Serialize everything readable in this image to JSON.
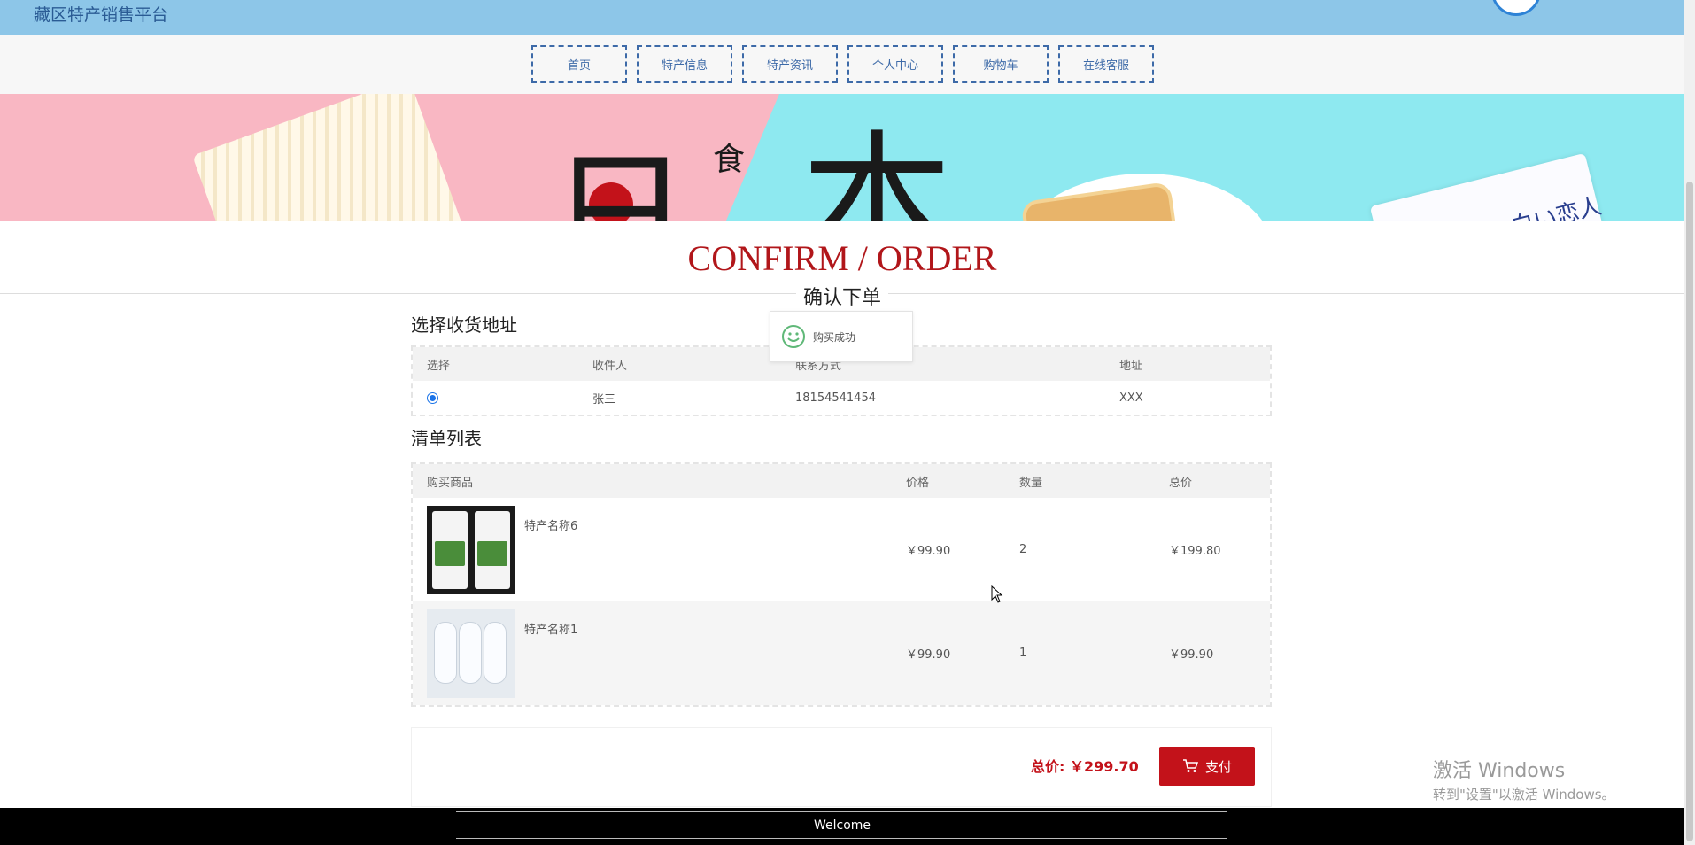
{
  "header": {
    "site_title": "藏区特产销售平台"
  },
  "nav": [
    {
      "label": "首页"
    },
    {
      "label": "特产信息"
    },
    {
      "label": "特产资讯"
    },
    {
      "label": "个人中心"
    },
    {
      "label": "购物车"
    },
    {
      "label": "在线客服"
    }
  ],
  "banner": {
    "k1": "日",
    "k2": "食",
    "k3": "本",
    "pack_text": "白い恋人"
  },
  "page": {
    "title_en": "CONFIRM / ORDER",
    "title_cn": "确认下单"
  },
  "toast": {
    "message": "购买成功"
  },
  "address": {
    "section_title": "选择收货地址",
    "headers": [
      "选择",
      "收件人",
      "联系方式",
      "地址"
    ],
    "rows": [
      {
        "recipient": "张三",
        "phone": "18154541454",
        "address": "XXX"
      }
    ]
  },
  "items": {
    "section_title": "清单列表",
    "headers": [
      "购买商品",
      "价格",
      "数量",
      "总价"
    ],
    "rows": [
      {
        "name": "特产名称6",
        "price": "￥99.90",
        "qty": "2",
        "total": "￥199.80"
      },
      {
        "name": "特产名称1",
        "price": "￥99.90",
        "qty": "1",
        "total": "￥99.90"
      }
    ]
  },
  "summary": {
    "total_label": "总价:  ￥299.70",
    "pay_label": "支付"
  },
  "footer": {
    "text": "Welcome"
  },
  "watermark": {
    "line1": "激活 Windows",
    "line2": "转到\"设置\"以激活 Windows。"
  },
  "colors": {
    "accent": "#c3121a",
    "header_bg": "#8dc6e8",
    "nav_border": "#3d6aa8"
  }
}
